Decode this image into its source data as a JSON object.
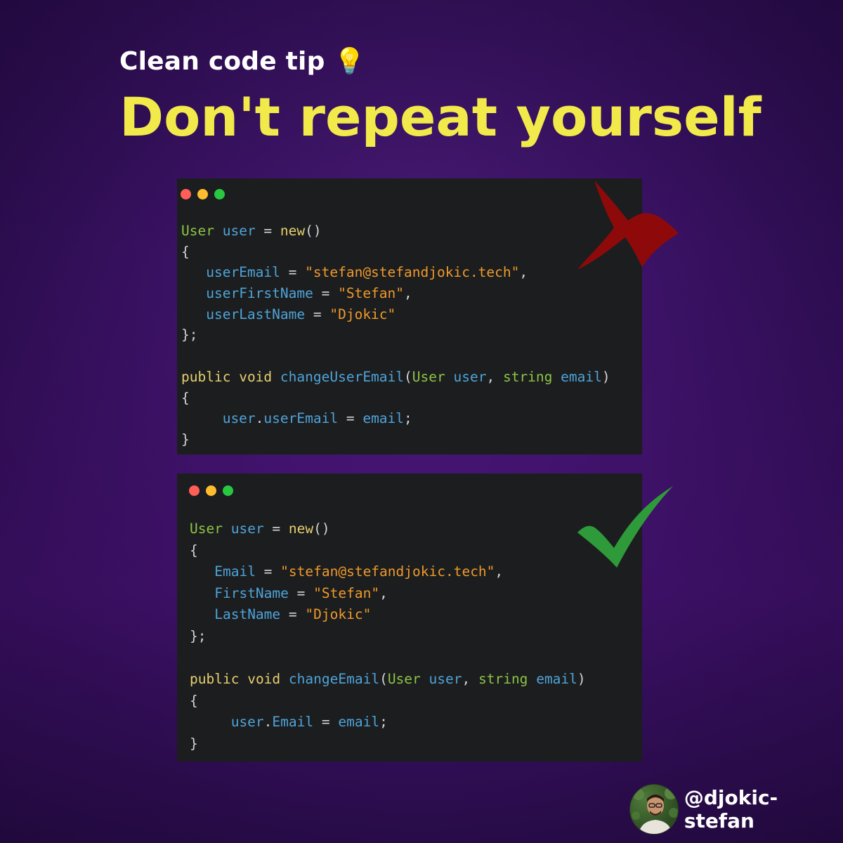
{
  "header": {
    "subtitle": "Clean code tip 💡",
    "title": "Don't repeat yourself"
  },
  "bad_example": {
    "status_icon": "red-x-mark",
    "lines": [
      [
        [
          "type",
          "User"
        ],
        [
          "punc",
          " "
        ],
        [
          "var",
          "user"
        ],
        [
          "punc",
          " = "
        ],
        [
          "kw",
          "new"
        ],
        [
          "punc",
          "()"
        ]
      ],
      [
        [
          "punc",
          "{"
        ]
      ],
      [
        [
          "punc",
          "   "
        ],
        [
          "var",
          "userEmail"
        ],
        [
          "punc",
          " = "
        ],
        [
          "str",
          "\"stefan@stefandjokic.tech\""
        ],
        [
          "punc",
          ","
        ]
      ],
      [
        [
          "punc",
          "   "
        ],
        [
          "var",
          "userFirstName"
        ],
        [
          "punc",
          " = "
        ],
        [
          "str",
          "\"Stefan\""
        ],
        [
          "punc",
          ","
        ]
      ],
      [
        [
          "punc",
          "   "
        ],
        [
          "var",
          "userLastName"
        ],
        [
          "punc",
          " = "
        ],
        [
          "str",
          "\"Djokic\""
        ]
      ],
      [
        [
          "punc",
          "};"
        ]
      ],
      [
        [
          "punc",
          ""
        ]
      ],
      [
        [
          "kw",
          "public"
        ],
        [
          "punc",
          " "
        ],
        [
          "kw",
          "void"
        ],
        [
          "punc",
          " "
        ],
        [
          "fn",
          "changeUserEmail"
        ],
        [
          "punc",
          "("
        ],
        [
          "type",
          "User"
        ],
        [
          "punc",
          " "
        ],
        [
          "var",
          "user"
        ],
        [
          "punc",
          ", "
        ],
        [
          "type",
          "string"
        ],
        [
          "punc",
          " "
        ],
        [
          "var",
          "email"
        ],
        [
          "punc",
          ")"
        ]
      ],
      [
        [
          "punc",
          "{"
        ]
      ],
      [
        [
          "punc",
          "     "
        ],
        [
          "var",
          "user"
        ],
        [
          "punc",
          "."
        ],
        [
          "var",
          "userEmail"
        ],
        [
          "punc",
          " = "
        ],
        [
          "var",
          "email"
        ],
        [
          "punc",
          ";"
        ]
      ],
      [
        [
          "punc",
          "}"
        ]
      ]
    ]
  },
  "good_example": {
    "status_icon": "green-check-mark",
    "lines": [
      [
        [
          "type",
          "User"
        ],
        [
          "punc",
          " "
        ],
        [
          "var",
          "user"
        ],
        [
          "punc",
          " = "
        ],
        [
          "kw",
          "new"
        ],
        [
          "punc",
          "()"
        ]
      ],
      [
        [
          "punc",
          "{"
        ]
      ],
      [
        [
          "punc",
          "   "
        ],
        [
          "var",
          "Email"
        ],
        [
          "punc",
          " = "
        ],
        [
          "str",
          "\"stefan@stefandjokic.tech\""
        ],
        [
          "punc",
          ","
        ]
      ],
      [
        [
          "punc",
          "   "
        ],
        [
          "var",
          "FirstName"
        ],
        [
          "punc",
          " = "
        ],
        [
          "str",
          "\"Stefan\""
        ],
        [
          "punc",
          ","
        ]
      ],
      [
        [
          "punc",
          "   "
        ],
        [
          "var",
          "LastName"
        ],
        [
          "punc",
          " = "
        ],
        [
          "str",
          "\"Djokic\""
        ]
      ],
      [
        [
          "punc",
          "};"
        ]
      ],
      [
        [
          "punc",
          ""
        ]
      ],
      [
        [
          "kw",
          "public"
        ],
        [
          "punc",
          " "
        ],
        [
          "kw",
          "void"
        ],
        [
          "punc",
          " "
        ],
        [
          "fn",
          "changeEmail"
        ],
        [
          "punc",
          "("
        ],
        [
          "type",
          "User"
        ],
        [
          "punc",
          " "
        ],
        [
          "var",
          "user"
        ],
        [
          "punc",
          ", "
        ],
        [
          "type",
          "string"
        ],
        [
          "punc",
          " "
        ],
        [
          "var",
          "email"
        ],
        [
          "punc",
          ")"
        ]
      ],
      [
        [
          "punc",
          "{"
        ]
      ],
      [
        [
          "punc",
          "     "
        ],
        [
          "var",
          "user"
        ],
        [
          "punc",
          "."
        ],
        [
          "var",
          "Email"
        ],
        [
          "punc",
          " = "
        ],
        [
          "var",
          "email"
        ],
        [
          "punc",
          ";"
        ]
      ],
      [
        [
          "punc",
          "}"
        ]
      ]
    ]
  },
  "author": {
    "handle": "@djokic-stefan",
    "avatar_icon": "profile-photo"
  },
  "colors": {
    "title_yellow": "#f2ea4a",
    "type_green": "#8dc445",
    "var_blue": "#4ea4d8",
    "keyword_yellow": "#e6d06e",
    "string_orange": "#ee9a2a",
    "x_red": "#8e0a0a",
    "check_green": "#2e9a3a"
  }
}
